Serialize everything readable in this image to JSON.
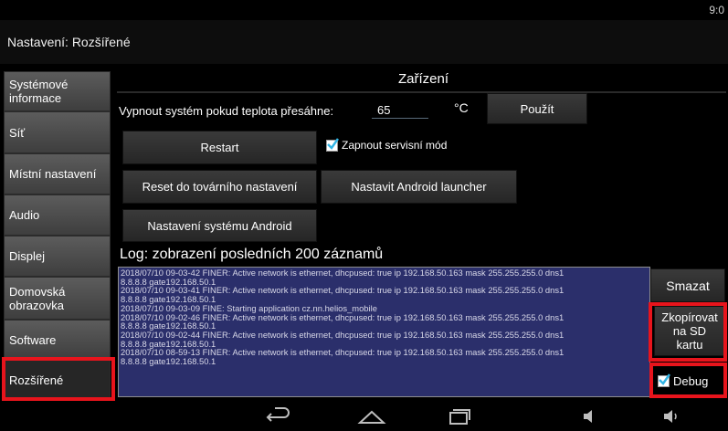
{
  "status_bar": {
    "time": "9:0"
  },
  "action_bar": {
    "title": "Nastavení: Rozšířené"
  },
  "sidebar": {
    "items": [
      {
        "label": "Systémové informace"
      },
      {
        "label": "Síť"
      },
      {
        "label": "Místní nastavení"
      },
      {
        "label": "Audio"
      },
      {
        "label": "Displej"
      },
      {
        "label": "Domovská obrazovka"
      },
      {
        "label": "Software"
      },
      {
        "label": "Rozšířené",
        "selected": true
      }
    ]
  },
  "device": {
    "title": "Zařízení",
    "temp_label": "Vypnout systém pokud teplota přesáhne:",
    "temp_value": "65",
    "temp_unit": "°C",
    "apply_label": "Použít",
    "restart_label": "Restart",
    "service_mode_label": "Zapnout servisní mód",
    "service_mode_checked": true,
    "factory_reset_label": "Reset do továrního nastavení",
    "android_launcher_label": "Nastavit Android launcher",
    "android_settings_label": "Nastavení systému Android"
  },
  "log": {
    "title": "Log: zobrazení posledních 200 záznamů",
    "lines": [
      "2018/07/10 09-03-42 FINER: Active network is ethernet,  dhcpused: true ip 192.168.50.163 mask 255.255.255.0 dns1",
      "8.8.8.8 gate192.168.50.1",
      "2018/07/10 09-03-41 FINER: Active network is ethernet,  dhcpused: true ip 192.168.50.163 mask 255.255.255.0 dns1",
      "8.8.8.8 gate192.168.50.1",
      "2018/07/10 09-03-09 FINE: Starting application cz.nn.helios_mobile",
      "2018/07/10 09-02-46 FINER: Active network is ethernet,  dhcpused: true ip 192.168.50.163 mask 255.255.255.0 dns1",
      "8.8.8.8 gate192.168.50.1",
      "2018/07/10 09-02-44 FINER: Active network is ethernet,  dhcpused: true ip 192.168.50.163 mask 255.255.255.0 dns1",
      "8.8.8.8 gate192.168.50.1",
      "2018/07/10 08-59-13 FINER: Active network is ethernet,  dhcpused: true ip 192.168.50.163 mask 255.255.255.0 dns1",
      "8.8.8.8 gate192.168.50.1"
    ],
    "clear_label": "Smazat",
    "copy_label_lines": [
      "Zkopírovat",
      "na SD",
      "kartu"
    ],
    "debug_label": "Debug",
    "debug_checked": true
  },
  "nav_bar": {
    "icons": [
      "back-icon",
      "home-icon",
      "recents-icon",
      "volume-down-icon",
      "volume-up-icon"
    ]
  },
  "colors": {
    "accent": "#33b5e5",
    "highlight": "#e8141c",
    "log_background": "#2b2f6b"
  }
}
